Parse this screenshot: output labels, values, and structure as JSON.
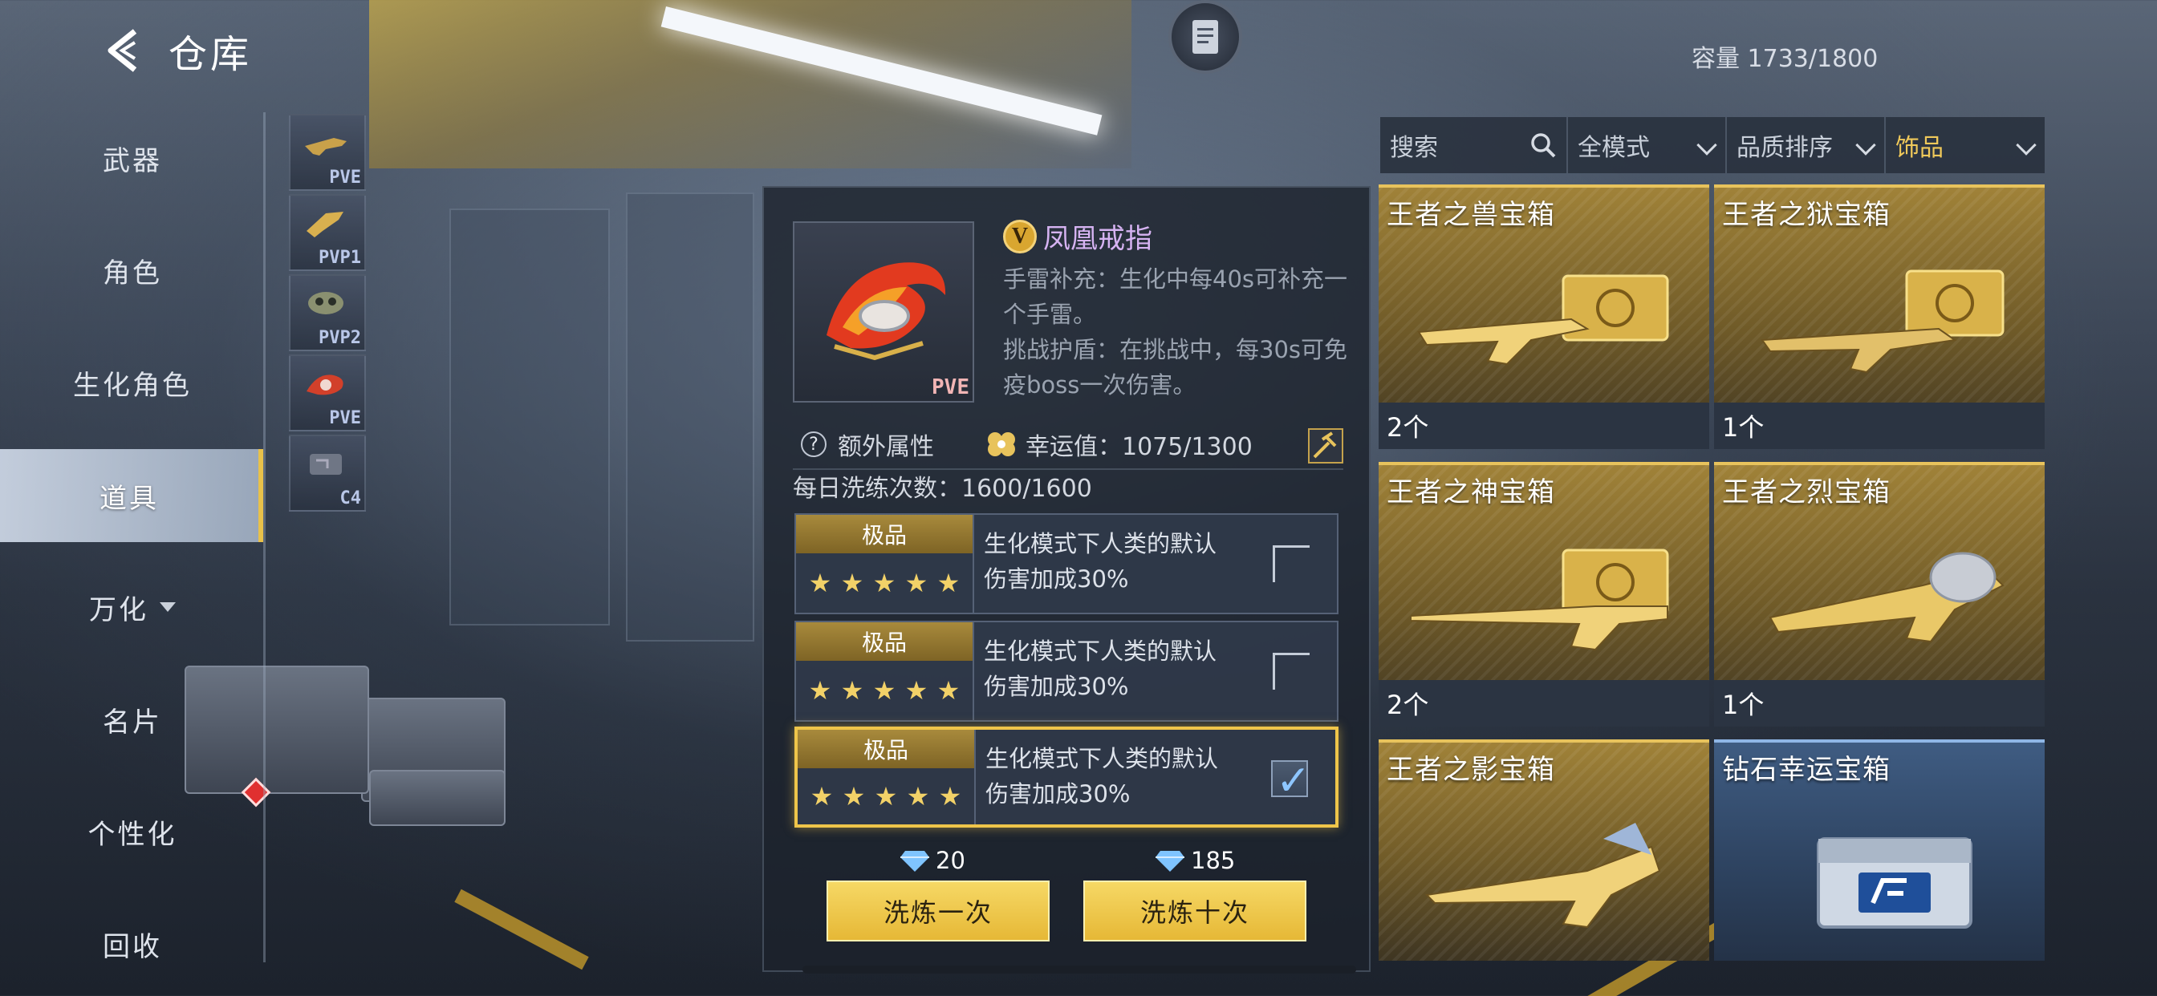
{
  "header": {
    "title": "仓库",
    "capacity": "容量  1733/1800"
  },
  "nav": {
    "items": [
      {
        "label": "武器"
      },
      {
        "label": "角色"
      },
      {
        "label": "生化角色"
      },
      {
        "label": "道具"
      },
      {
        "label": "万化"
      },
      {
        "label": "名片"
      },
      {
        "label": "个性化"
      },
      {
        "label": "回收"
      }
    ],
    "active": "道具"
  },
  "thumbs": [
    "PVE",
    "PVP1",
    "PVP2",
    "PVE",
    "C4"
  ],
  "item": {
    "tag": "PVE",
    "badge": "V",
    "name": "凤凰戒指",
    "desc_1": "手雷补充：生化中每40s可补充一个手雷。",
    "desc_2": "挑战护盾：在挑战中，每30s可免疫boss一次伤害。"
  },
  "attributes": {
    "extra_label": "额外属性",
    "luck_label": "幸运值：1075/1300",
    "daily_label": "每日洗练次数：1600/1600"
  },
  "options": [
    {
      "grade": "极品",
      "text_1": "生化模式下人类的默认",
      "text_2": "伤害加成30%",
      "checked": false
    },
    {
      "grade": "极品",
      "text_1": "生化模式下人类的默认",
      "text_2": "伤害加成30%",
      "checked": false
    },
    {
      "grade": "极品",
      "text_1": "生化模式下人类的默认",
      "text_2": "伤害加成30%",
      "checked": true
    }
  ],
  "actions": {
    "once_cost": "20",
    "once_label": "洗炼一次",
    "ten_cost": "185",
    "ten_label": "洗炼十次"
  },
  "filters": {
    "search_placeholder": "搜索",
    "mode": "全模式",
    "sort": "品质排序",
    "category": "饰品"
  },
  "cards": [
    {
      "title": "王者之兽宝箱",
      "count": "2个"
    },
    {
      "title": "王者之狱宝箱",
      "count": "1个"
    },
    {
      "title": "王者之神宝箱",
      "count": "2个"
    },
    {
      "title": "王者之烈宝箱",
      "count": "1个"
    },
    {
      "title": "王者之影宝箱",
      "count": ""
    },
    {
      "title": "钻石幸运宝箱",
      "count": ""
    }
  ],
  "colors": {
    "accent": "#efc54a",
    "active_nav": "#c8d2e0",
    "item_name": "#d6b3f2"
  }
}
